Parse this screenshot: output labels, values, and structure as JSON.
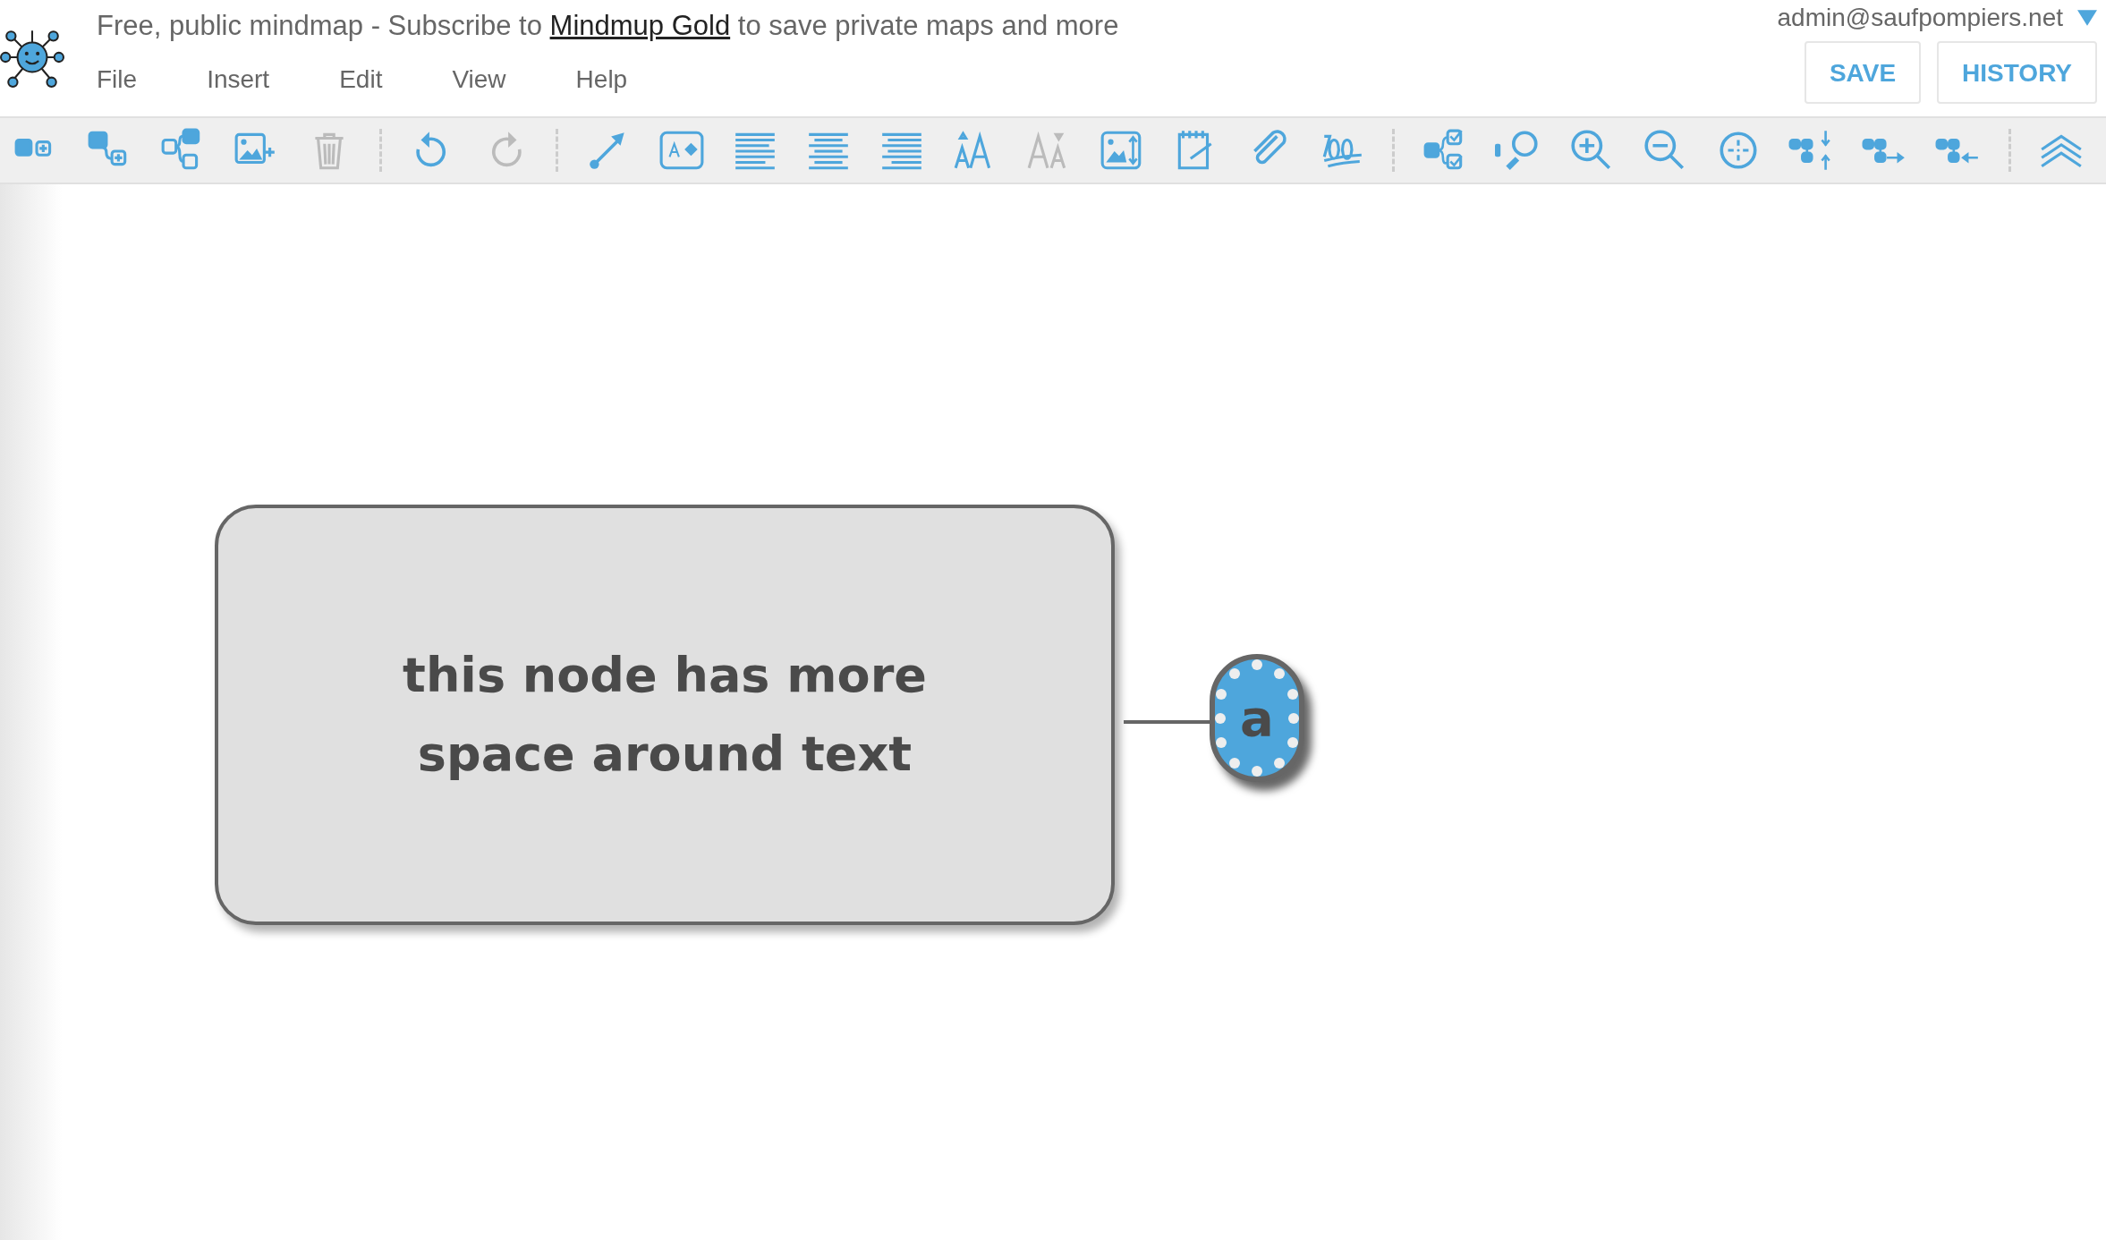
{
  "banner": {
    "before": "Free, public mindmap - Subscribe to",
    "link": "Mindmup Gold",
    "after": "to save private maps and more"
  },
  "menu": [
    "File",
    "Insert",
    "Edit",
    "View",
    "Help"
  ],
  "account": {
    "email": "admin@saufpompiers.net"
  },
  "buttons": [
    "SAVE",
    "HISTORY"
  ],
  "nodes": [
    {
      "text": "this node has more space around text",
      "color": "#e0e0e0",
      "kind": "root"
    },
    {
      "text": "a",
      "color": "#4ea6dc",
      "kind": "child"
    }
  ]
}
